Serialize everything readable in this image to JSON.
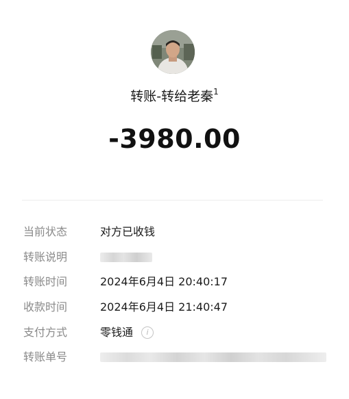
{
  "header": {
    "avatar_icon": "user-photo-avatar",
    "title": "转账-转给老秦",
    "title_superscript": "1",
    "amount": "-3980.00"
  },
  "details": {
    "status_label": "当前状态",
    "status_value": "对方已收钱",
    "note_label": "转账说明",
    "transfer_time_label": "转账时间",
    "transfer_time_value": "2024年6月4日 20:40:17",
    "receive_time_label": "收款时间",
    "receive_time_value": "2024年6月4日 21:40:47",
    "payment_method_label": "支付方式",
    "payment_method_value": "零钱通",
    "payment_method_info_icon": "info-icon",
    "transfer_number_label": "转账单号"
  }
}
